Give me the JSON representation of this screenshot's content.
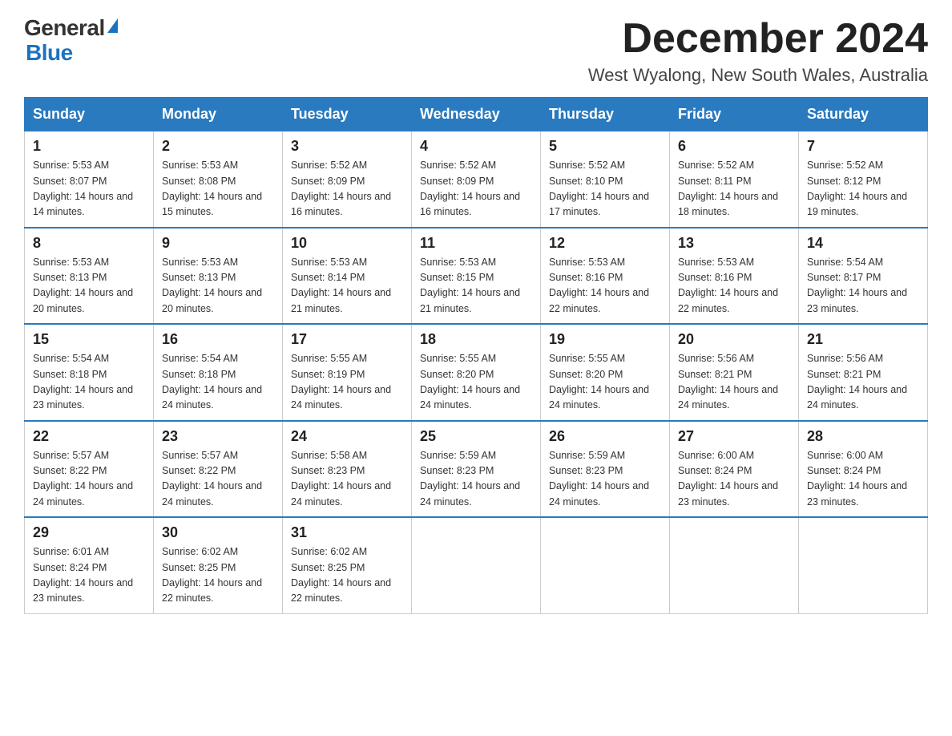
{
  "logo": {
    "general": "General",
    "blue": "Blue",
    "arrow": "▶"
  },
  "title": "December 2024",
  "subtitle": "West Wyalong, New South Wales, Australia",
  "weekdays": [
    "Sunday",
    "Monday",
    "Tuesday",
    "Wednesday",
    "Thursday",
    "Friday",
    "Saturday"
  ],
  "weeks": [
    [
      {
        "day": "1",
        "sunrise": "5:53 AM",
        "sunset": "8:07 PM",
        "daylight": "14 hours and 14 minutes."
      },
      {
        "day": "2",
        "sunrise": "5:53 AM",
        "sunset": "8:08 PM",
        "daylight": "14 hours and 15 minutes."
      },
      {
        "day": "3",
        "sunrise": "5:52 AM",
        "sunset": "8:09 PM",
        "daylight": "14 hours and 16 minutes."
      },
      {
        "day": "4",
        "sunrise": "5:52 AM",
        "sunset": "8:09 PM",
        "daylight": "14 hours and 16 minutes."
      },
      {
        "day": "5",
        "sunrise": "5:52 AM",
        "sunset": "8:10 PM",
        "daylight": "14 hours and 17 minutes."
      },
      {
        "day": "6",
        "sunrise": "5:52 AM",
        "sunset": "8:11 PM",
        "daylight": "14 hours and 18 minutes."
      },
      {
        "day": "7",
        "sunrise": "5:52 AM",
        "sunset": "8:12 PM",
        "daylight": "14 hours and 19 minutes."
      }
    ],
    [
      {
        "day": "8",
        "sunrise": "5:53 AM",
        "sunset": "8:13 PM",
        "daylight": "14 hours and 20 minutes."
      },
      {
        "day": "9",
        "sunrise": "5:53 AM",
        "sunset": "8:13 PM",
        "daylight": "14 hours and 20 minutes."
      },
      {
        "day": "10",
        "sunrise": "5:53 AM",
        "sunset": "8:14 PM",
        "daylight": "14 hours and 21 minutes."
      },
      {
        "day": "11",
        "sunrise": "5:53 AM",
        "sunset": "8:15 PM",
        "daylight": "14 hours and 21 minutes."
      },
      {
        "day": "12",
        "sunrise": "5:53 AM",
        "sunset": "8:16 PM",
        "daylight": "14 hours and 22 minutes."
      },
      {
        "day": "13",
        "sunrise": "5:53 AM",
        "sunset": "8:16 PM",
        "daylight": "14 hours and 22 minutes."
      },
      {
        "day": "14",
        "sunrise": "5:54 AM",
        "sunset": "8:17 PM",
        "daylight": "14 hours and 23 minutes."
      }
    ],
    [
      {
        "day": "15",
        "sunrise": "5:54 AM",
        "sunset": "8:18 PM",
        "daylight": "14 hours and 23 minutes."
      },
      {
        "day": "16",
        "sunrise": "5:54 AM",
        "sunset": "8:18 PM",
        "daylight": "14 hours and 24 minutes."
      },
      {
        "day": "17",
        "sunrise": "5:55 AM",
        "sunset": "8:19 PM",
        "daylight": "14 hours and 24 minutes."
      },
      {
        "day": "18",
        "sunrise": "5:55 AM",
        "sunset": "8:20 PM",
        "daylight": "14 hours and 24 minutes."
      },
      {
        "day": "19",
        "sunrise": "5:55 AM",
        "sunset": "8:20 PM",
        "daylight": "14 hours and 24 minutes."
      },
      {
        "day": "20",
        "sunrise": "5:56 AM",
        "sunset": "8:21 PM",
        "daylight": "14 hours and 24 minutes."
      },
      {
        "day": "21",
        "sunrise": "5:56 AM",
        "sunset": "8:21 PM",
        "daylight": "14 hours and 24 minutes."
      }
    ],
    [
      {
        "day": "22",
        "sunrise": "5:57 AM",
        "sunset": "8:22 PM",
        "daylight": "14 hours and 24 minutes."
      },
      {
        "day": "23",
        "sunrise": "5:57 AM",
        "sunset": "8:22 PM",
        "daylight": "14 hours and 24 minutes."
      },
      {
        "day": "24",
        "sunrise": "5:58 AM",
        "sunset": "8:23 PM",
        "daylight": "14 hours and 24 minutes."
      },
      {
        "day": "25",
        "sunrise": "5:59 AM",
        "sunset": "8:23 PM",
        "daylight": "14 hours and 24 minutes."
      },
      {
        "day": "26",
        "sunrise": "5:59 AM",
        "sunset": "8:23 PM",
        "daylight": "14 hours and 24 minutes."
      },
      {
        "day": "27",
        "sunrise": "6:00 AM",
        "sunset": "8:24 PM",
        "daylight": "14 hours and 23 minutes."
      },
      {
        "day": "28",
        "sunrise": "6:00 AM",
        "sunset": "8:24 PM",
        "daylight": "14 hours and 23 minutes."
      }
    ],
    [
      {
        "day": "29",
        "sunrise": "6:01 AM",
        "sunset": "8:24 PM",
        "daylight": "14 hours and 23 minutes."
      },
      {
        "day": "30",
        "sunrise": "6:02 AM",
        "sunset": "8:25 PM",
        "daylight": "14 hours and 22 minutes."
      },
      {
        "day": "31",
        "sunrise": "6:02 AM",
        "sunset": "8:25 PM",
        "daylight": "14 hours and 22 minutes."
      },
      null,
      null,
      null,
      null
    ]
  ]
}
